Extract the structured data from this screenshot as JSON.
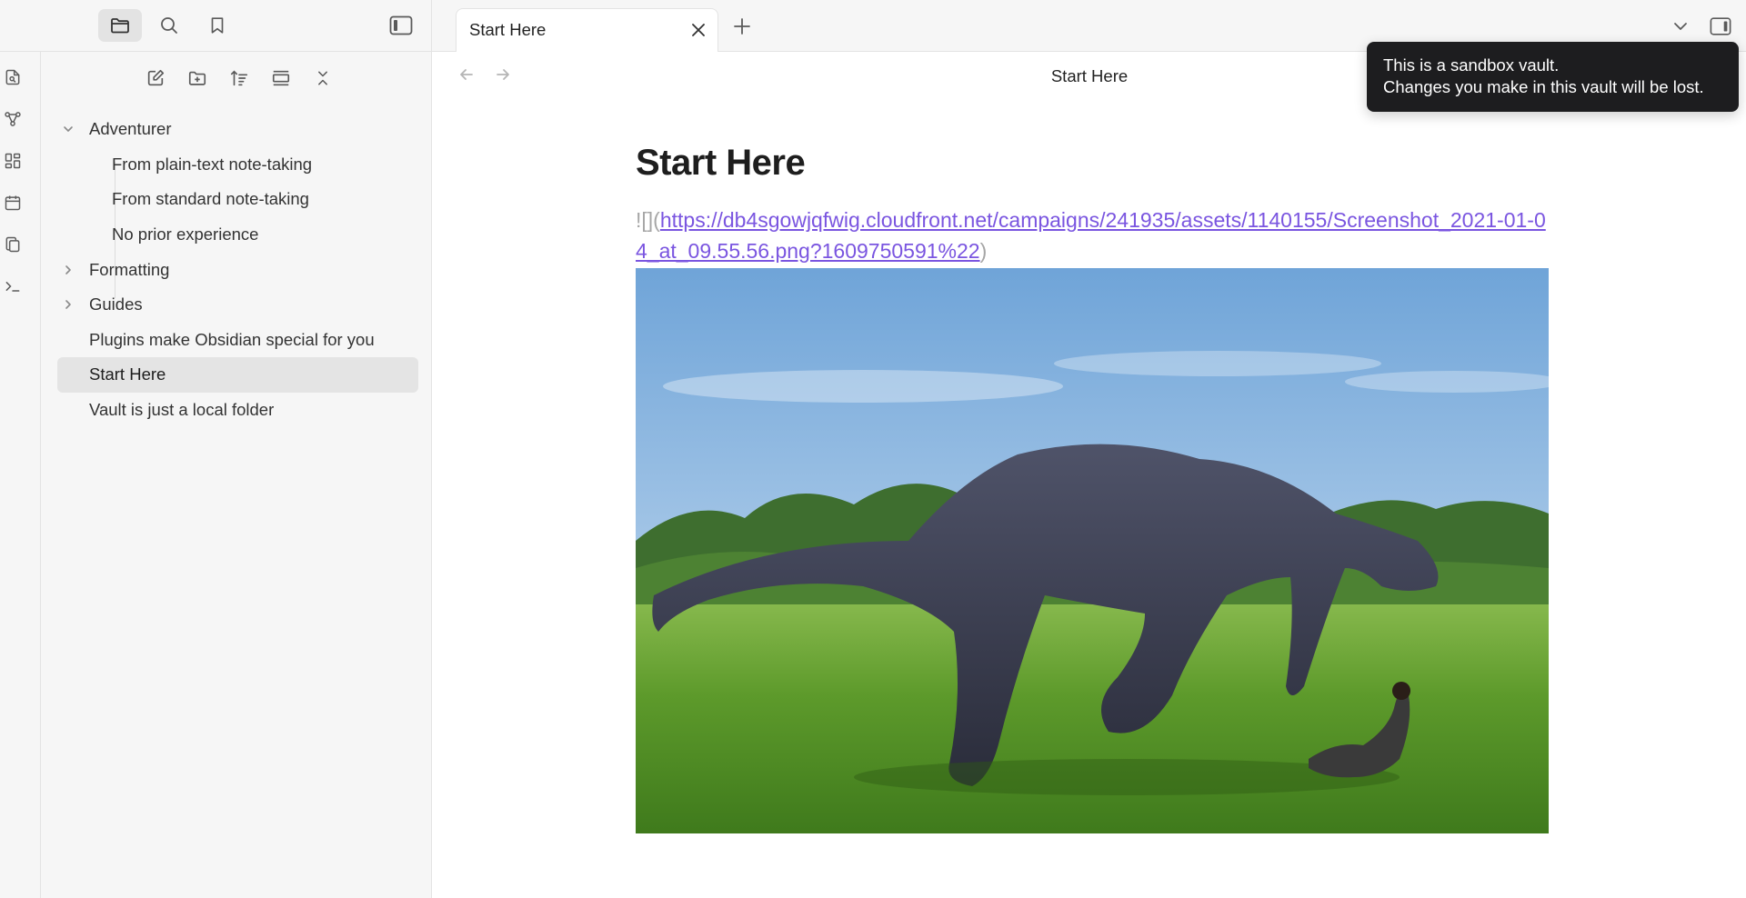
{
  "window": {
    "title": "Start Here"
  },
  "sidebar": {
    "tabs": [
      {
        "icon": "folder-icon",
        "active": true
      },
      {
        "icon": "search-icon",
        "active": false
      },
      {
        "icon": "bookmark-icon",
        "active": false
      }
    ],
    "actions": [
      "new-note-icon",
      "new-folder-icon",
      "sort-icon",
      "auto-reveal-icon",
      "collapse-all-icon"
    ],
    "tree": [
      {
        "label": "Adventurer",
        "type": "folder",
        "expanded": true,
        "depth": 0
      },
      {
        "label": "From plain-text note-taking",
        "type": "file",
        "depth": 1
      },
      {
        "label": "From standard note-taking",
        "type": "file",
        "depth": 1
      },
      {
        "label": "No prior experience",
        "type": "file",
        "depth": 1
      },
      {
        "label": "Formatting",
        "type": "folder",
        "expanded": false,
        "depth": 0
      },
      {
        "label": "Guides",
        "type": "folder",
        "expanded": false,
        "depth": 0
      },
      {
        "label": "Plugins make Obsidian special for you",
        "type": "file",
        "depth": 0
      },
      {
        "label": "Start Here",
        "type": "file",
        "depth": 0,
        "selected": true
      },
      {
        "label": "Vault is just a local folder",
        "type": "file",
        "depth": 0
      }
    ]
  },
  "ribbon": [
    "quick-switcher-icon",
    "graph-icon",
    "canvas-icon",
    "daily-note-icon",
    "templates-icon",
    "command-palette-icon"
  ],
  "tabs": [
    {
      "title": "Start Here"
    }
  ],
  "view": {
    "title": "Start Here"
  },
  "document": {
    "heading": "Start Here",
    "embed_prefix": "![](",
    "embed_url": "https://db4sgowjqfwig.cloudfront.net/campaigns/241935/assets/1140155/Screenshot_2021-01-04_at_09.55.56.png?1609750591%22",
    "embed_suffix": ")",
    "image_alt": "dinosaur-image"
  },
  "notice": {
    "line1": "This is a sandbox vault.",
    "line2": "Changes you make in this vault will be lost."
  },
  "colors": {
    "link": "#7a55e0",
    "sidebar_bg": "#f6f6f6",
    "notice_bg": "#1d1d1f"
  }
}
